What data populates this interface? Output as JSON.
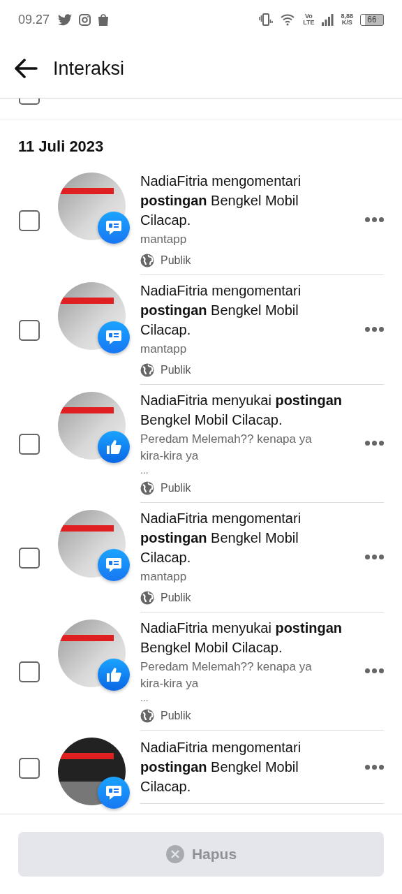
{
  "status_bar": {
    "time": "09.27",
    "network_type": "Vo\nLTE",
    "speed": "8,88\nK/S",
    "battery": "66"
  },
  "header": {
    "title": "Interaksi"
  },
  "select_all": {
    "checked": false
  },
  "date_heading": "11 Juli 2023",
  "items": [
    {
      "kind": "comment",
      "thumb_dark": false,
      "checked": false,
      "text": "NadiaFitria mengomentari **postingan** Bengkel Mobil Cilacap.",
      "snippet": "mantapp",
      "privacy": "Publik"
    },
    {
      "kind": "comment",
      "thumb_dark": false,
      "checked": false,
      "text": "NadiaFitria mengomentari **postingan** Bengkel Mobil Cilacap.",
      "snippet": "mantapp",
      "privacy": "Publik"
    },
    {
      "kind": "like",
      "thumb_dark": false,
      "checked": false,
      "text": "NadiaFitria menyukai **postingan** Bengkel Mobil Cilacap.",
      "snippet": "Peredam Melemah?? kenapa ya kira-kira ya",
      "snippet_more": "...",
      "privacy": "Publik"
    },
    {
      "kind": "comment",
      "thumb_dark": false,
      "checked": false,
      "text": "NadiaFitria mengomentari **postingan** Bengkel Mobil Cilacap.",
      "snippet": "mantapp",
      "privacy": "Publik"
    },
    {
      "kind": "like",
      "thumb_dark": false,
      "checked": false,
      "text": "NadiaFitria menyukai **postingan** Bengkel Mobil Cilacap.",
      "snippet": "Peredam Melemah?? kenapa ya kira-kira ya",
      "snippet_more": "...",
      "privacy": "Publik"
    },
    {
      "kind": "comment",
      "thumb_dark": true,
      "checked": false,
      "text": "NadiaFitria mengomentari **postingan** Bengkel Mobil Cilacap."
    }
  ],
  "footer": {
    "button": "Hapus",
    "disabled": true
  }
}
